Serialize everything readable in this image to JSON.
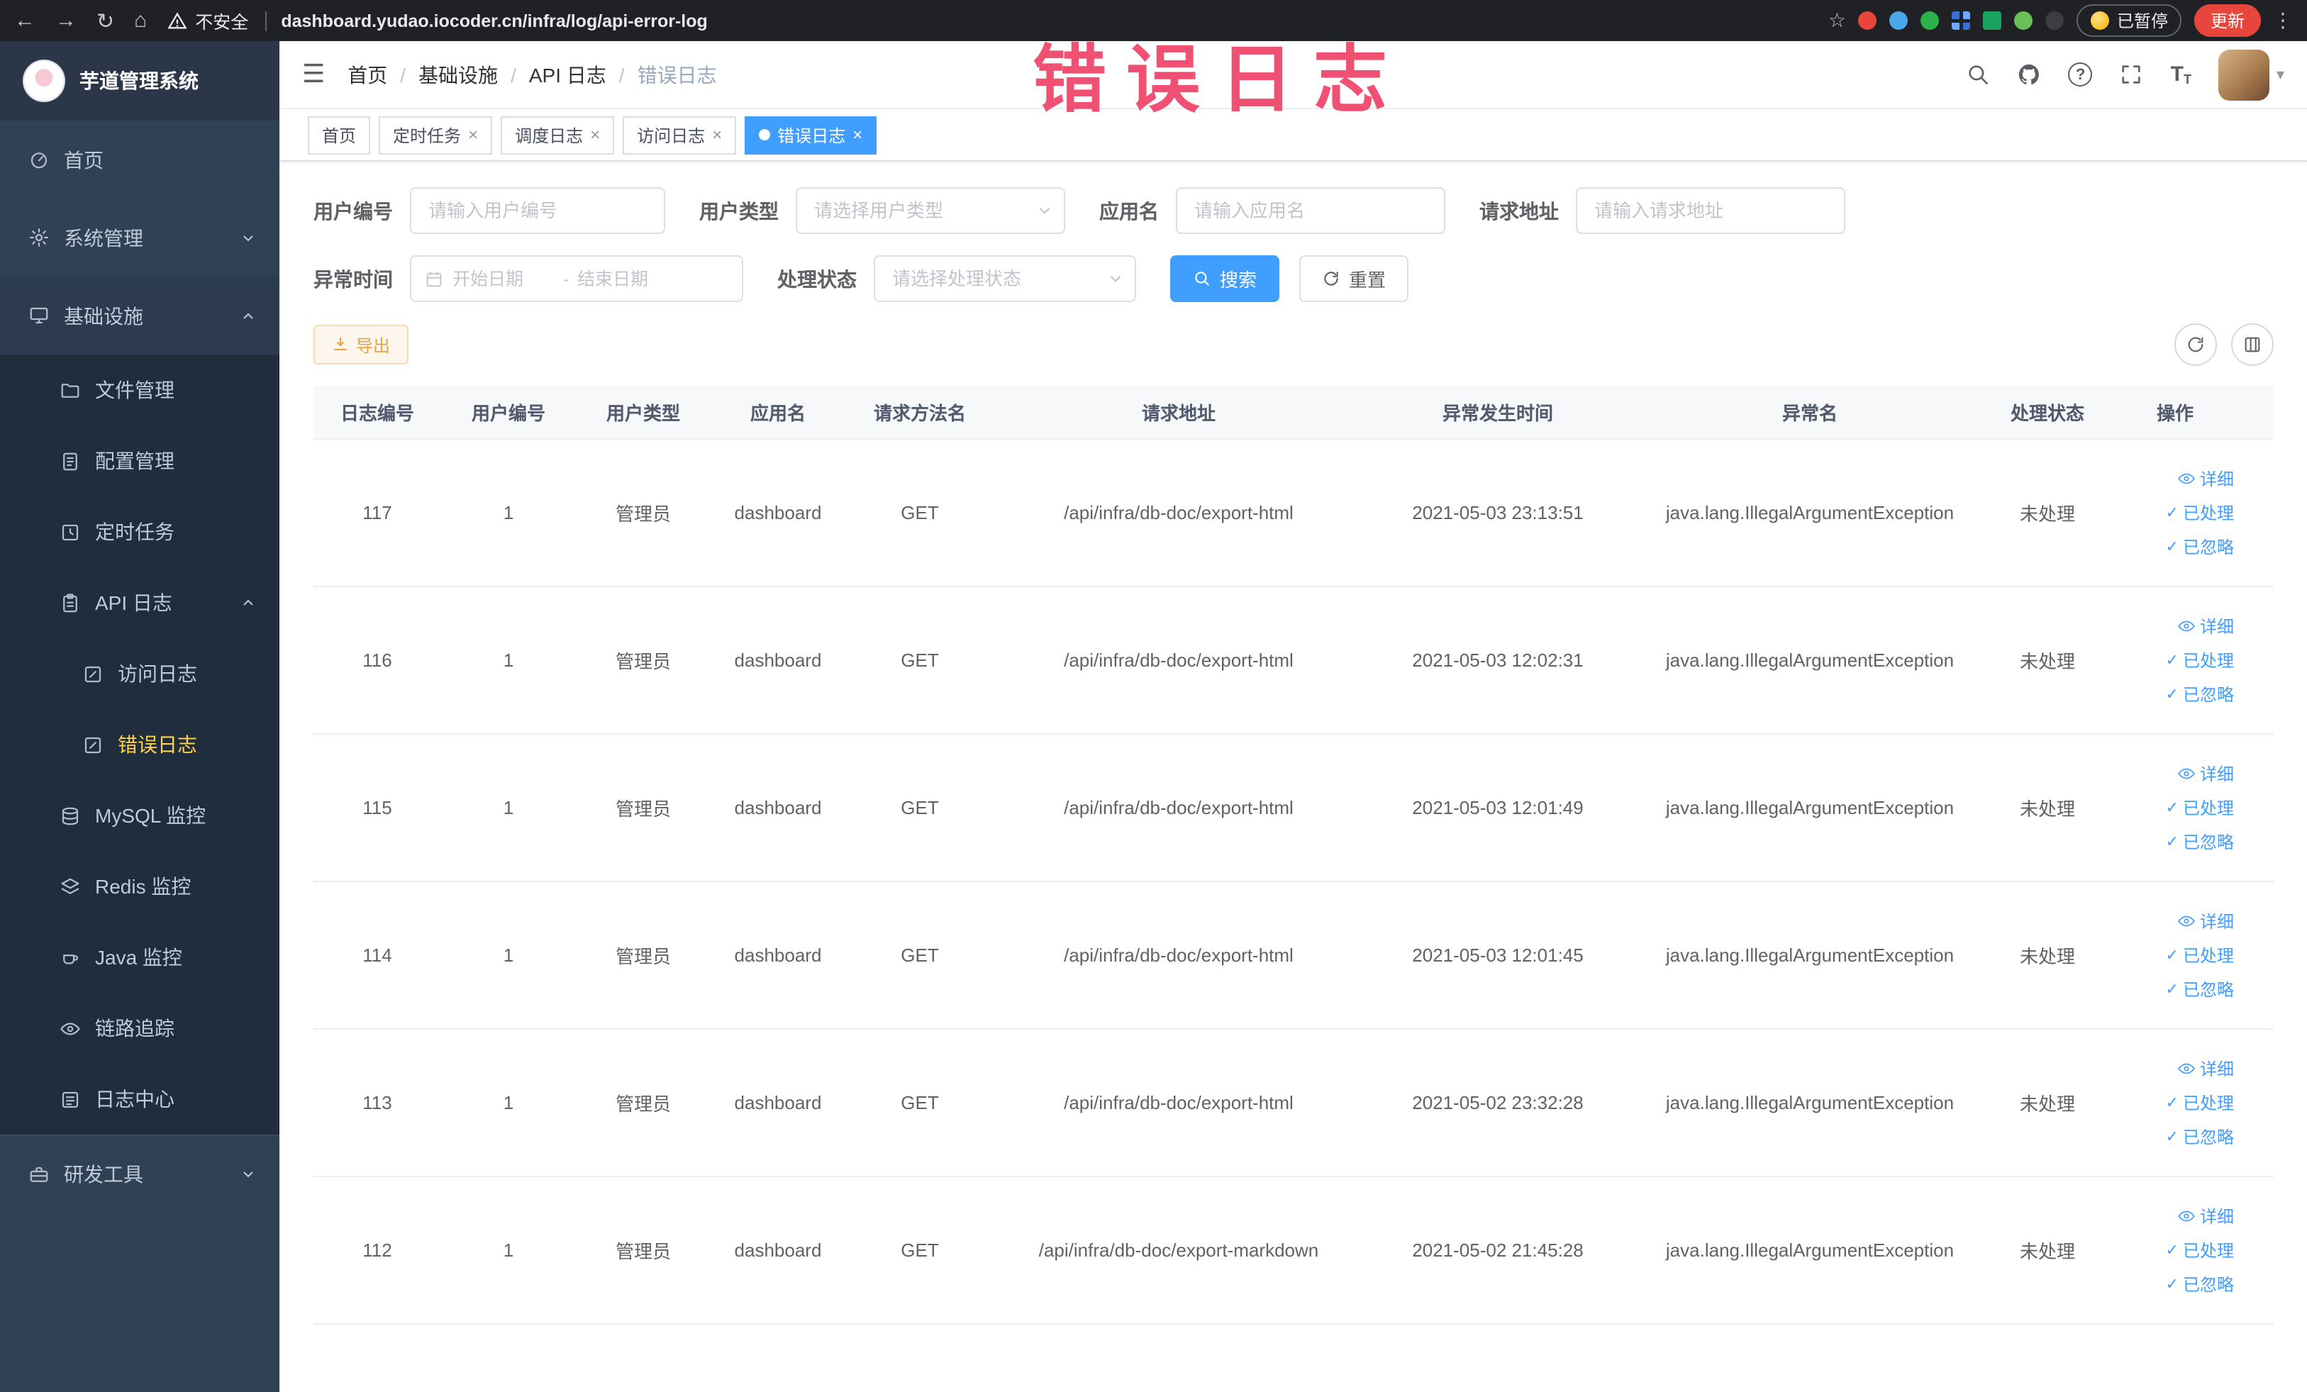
{
  "browser": {
    "security_label": "不安全",
    "url": "dashboard.yudao.iocoder.cn/infra/log/api-error-log",
    "paused_badge_label": "已暂停",
    "update_button_label": "更新"
  },
  "icons": {
    "back": "←",
    "forward": "→",
    "reload": "↻",
    "home": "⌂",
    "star": "☆",
    "menu_dots": "⋮",
    "hamburger": "☰",
    "check": "✓",
    "question": "?",
    "close": "×",
    "caret_down": "▾",
    "font_big": "T",
    "font_small": "T",
    "breadcrumb_separator": "/"
  },
  "watermark": "错误日志",
  "sidebar": {
    "logo_title": "芋道管理系统",
    "home": "首页",
    "system_mgmt": "系统管理",
    "infrastructure": "基础设施",
    "file_mgmt": "文件管理",
    "config_mgmt": "配置管理",
    "scheduled_jobs": "定时任务",
    "api_log": "API 日志",
    "access_log": "访问日志",
    "error_log": "错误日志",
    "mysql_monitor": "MySQL 监控",
    "redis_monitor": "Redis 监控",
    "java_monitor": "Java 监控",
    "trace": "链路追踪",
    "log_center": "日志中心",
    "dev_tools": "研发工具"
  },
  "header": {
    "breadcrumb": [
      "首页",
      "基础设施",
      "API 日志",
      "错误日志"
    ]
  },
  "tabs": [
    {
      "label": "首页"
    },
    {
      "label": "定时任务"
    },
    {
      "label": "调度日志"
    },
    {
      "label": "访问日志"
    },
    {
      "label": "错误日志"
    }
  ],
  "filters": {
    "user_id": {
      "label": "用户编号",
      "placeholder": "请输入用户编号"
    },
    "user_type": {
      "label": "用户类型",
      "placeholder": "请选择用户类型"
    },
    "app_name": {
      "label": "应用名",
      "placeholder": "请输入应用名"
    },
    "request_url": {
      "label": "请求地址",
      "placeholder": "请输入请求地址"
    },
    "exception_time": {
      "label": "异常时间",
      "start_placeholder": "开始日期",
      "separator": "-",
      "end_placeholder": "结束日期"
    },
    "process_status": {
      "label": "处理状态",
      "placeholder": "请选择处理状态"
    },
    "search_label": "搜索",
    "reset_label": "重置"
  },
  "toolbar": {
    "export_label": "导出"
  },
  "table": {
    "headers": [
      "日志编号",
      "用户编号",
      "用户类型",
      "应用名",
      "请求方法名",
      "请求地址",
      "异常发生时间",
      "异常名",
      "处理状态",
      "操作"
    ],
    "actions": {
      "detail": "详细",
      "processed": "已处理",
      "ignored": "已忽略"
    },
    "rows": [
      {
        "log_id": "117",
        "user_id": "1",
        "user_type": "管理员",
        "app_name": "dashboard",
        "method": "GET",
        "url": "/api/infra/db-doc/export-html",
        "time": "2021-05-03 23:13:51",
        "exception": "java.lang.IllegalArgumentException",
        "status": "未处理"
      },
      {
        "log_id": "116",
        "user_id": "1",
        "user_type": "管理员",
        "app_name": "dashboard",
        "method": "GET",
        "url": "/api/infra/db-doc/export-html",
        "time": "2021-05-03 12:02:31",
        "exception": "java.lang.IllegalArgumentException",
        "status": "未处理"
      },
      {
        "log_id": "115",
        "user_id": "1",
        "user_type": "管理员",
        "app_name": "dashboard",
        "method": "GET",
        "url": "/api/infra/db-doc/export-html",
        "time": "2021-05-03 12:01:49",
        "exception": "java.lang.IllegalArgumentException",
        "status": "未处理"
      },
      {
        "log_id": "114",
        "user_id": "1",
        "user_type": "管理员",
        "app_name": "dashboard",
        "method": "GET",
        "url": "/api/infra/db-doc/export-html",
        "time": "2021-05-03 12:01:45",
        "exception": "java.lang.IllegalArgumentException",
        "status": "未处理"
      },
      {
        "log_id": "113",
        "user_id": "1",
        "user_type": "管理员",
        "app_name": "dashboard",
        "method": "GET",
        "url": "/api/infra/db-doc/export-html",
        "time": "2021-05-02 23:32:28",
        "exception": "java.lang.IllegalArgumentException",
        "status": "未处理"
      },
      {
        "log_id": "112",
        "user_id": "1",
        "user_type": "管理员",
        "app_name": "dashboard",
        "method": "GET",
        "url": "/api/infra/db-doc/export-markdown",
        "time": "2021-05-02 21:45:28",
        "exception": "java.lang.IllegalArgumentException",
        "status": "未处理"
      }
    ]
  },
  "colors": {
    "accent": "#409eff",
    "sidebar_bg": "#304156",
    "sidebar_sub_bg": "#1f2d3d",
    "sidebar_active_text": "#ffd04b",
    "link": "#409eff",
    "warning": "#e6a23c",
    "watermark": "#ee3a5f",
    "update_button": "#e8453c"
  }
}
